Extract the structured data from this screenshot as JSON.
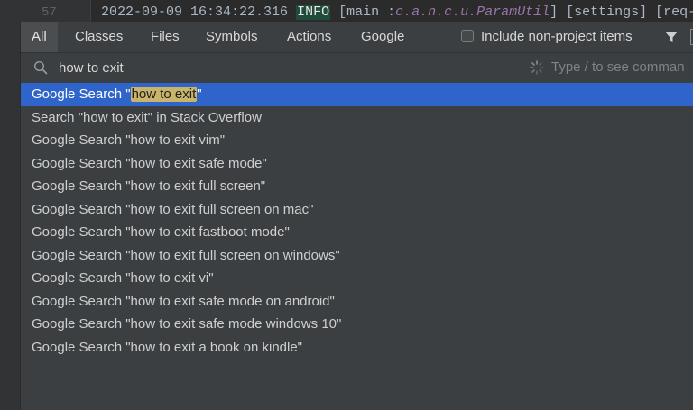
{
  "editor": {
    "line_number": "57",
    "timestamp": "2022-09-09 16:34:22.316",
    "level": "INFO",
    "bracket_open": " [main :",
    "class_path": "c.a.n.c.u.ParamUtil",
    "rest": "] [settings] [req-"
  },
  "tabs": [
    {
      "label": "All",
      "active": true
    },
    {
      "label": "Classes"
    },
    {
      "label": "Files"
    },
    {
      "label": "Symbols"
    },
    {
      "label": "Actions"
    },
    {
      "label": "Google"
    }
  ],
  "include_non_project": {
    "label": "Include non-project items",
    "checked": false
  },
  "search": {
    "query": "how to exit",
    "hint": "Type / to see comman"
  },
  "results": [
    {
      "prefix": "Google Search \"",
      "highlight": "how to exit",
      "suffix": "\"",
      "selected": true
    },
    {
      "text": "Search \"how to exit\" in Stack Overflow"
    },
    {
      "text": "Google Search \"how to exit vim\""
    },
    {
      "text": "Google Search \"how to exit safe mode\""
    },
    {
      "text": "Google Search \"how to exit full screen\""
    },
    {
      "text": "Google Search \"how to exit full screen on mac\""
    },
    {
      "text": "Google Search \"how to exit fastboot mode\""
    },
    {
      "text": "Google Search \"how to exit full screen on windows\""
    },
    {
      "text": "Google Search \"how to exit vi\""
    },
    {
      "text": "Google Search \"how to exit safe mode on android\""
    },
    {
      "text": "Google Search \"how to exit safe mode windows 10\""
    },
    {
      "text": "Google Search \"how to exit a book on kindle\""
    }
  ],
  "colors": {
    "selection": "#2f65ca",
    "highlight": "#c9b46a",
    "popup_bg": "#3c3f41"
  }
}
